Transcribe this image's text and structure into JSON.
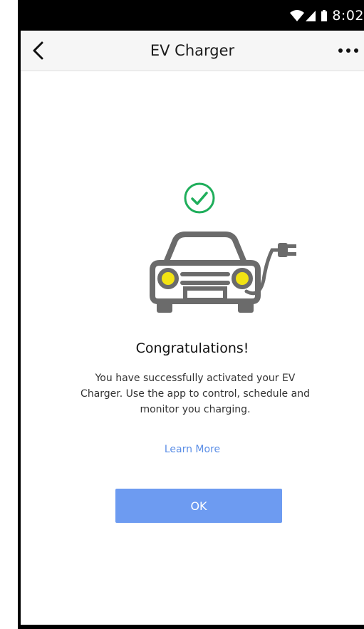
{
  "status_bar": {
    "time": "8:02",
    "icons": [
      "wifi-icon",
      "signal-icon",
      "battery-icon"
    ]
  },
  "app_bar": {
    "title": "EV Charger",
    "back_icon": "chevron-left-icon",
    "more_icon": "more-horizontal-icon"
  },
  "success": {
    "icon": "check-circle-icon",
    "illustration": "car-with-charging-plug",
    "headline": "Congratulations!",
    "message": "You have successfully activated your EV Charger. Use the app to control, schedule and monitor you charging.",
    "learn_more_label": "Learn More",
    "ok_label": "OK"
  },
  "colors": {
    "accent_green": "#1fae5b",
    "button_blue": "#6d9bf1",
    "link_blue": "#5b8ee6",
    "headlight_yellow": "#f2e313",
    "car_gray": "#6b6b6b"
  }
}
